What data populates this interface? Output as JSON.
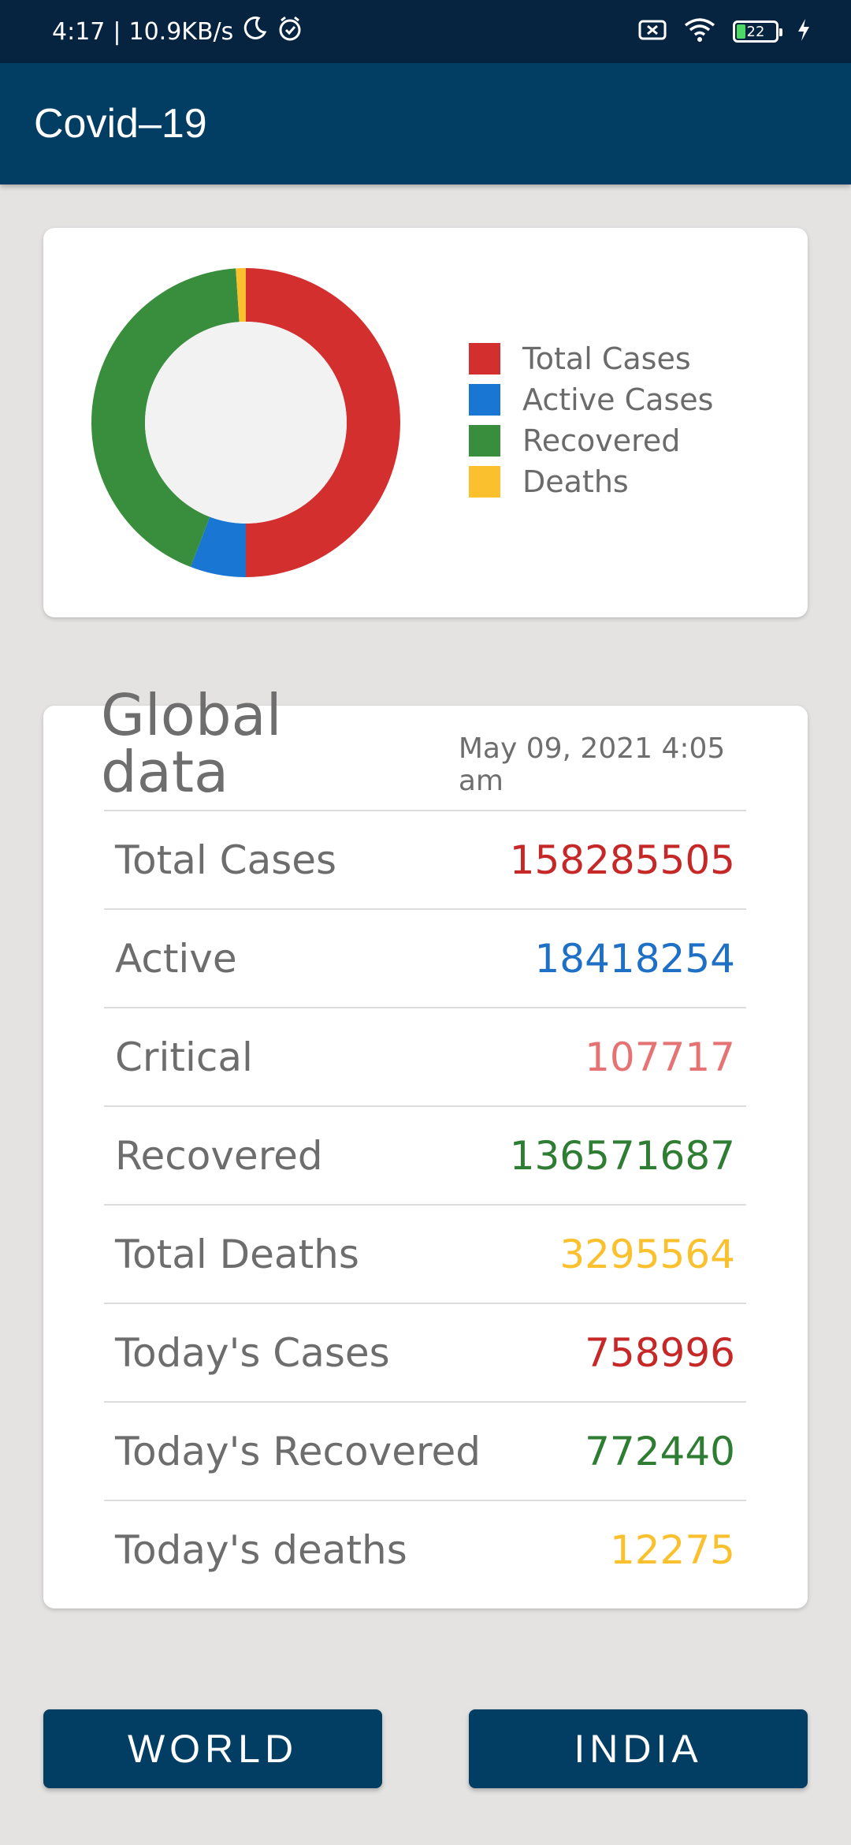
{
  "status_bar": {
    "time": "4:17",
    "speed": "10.9KB/s",
    "battery": "22"
  },
  "app": {
    "title": "Covid–19"
  },
  "chart_data": {
    "type": "pie",
    "style": "donut",
    "categories": [
      "Total Cases",
      "Active Cases",
      "Recovered",
      "Deaths"
    ],
    "values": [
      158285505,
      18418254,
      136571687,
      3295564
    ],
    "colors": [
      "#d32f2f",
      "#1976d2",
      "#388e3c",
      "#fbc02d"
    ],
    "legend_position": "right"
  },
  "global": {
    "title": "Global data",
    "date": "May 09, 2021 4:05 am",
    "rows": [
      {
        "label": "Total Cases",
        "value": "158285505",
        "color": "#c62828"
      },
      {
        "label": "Active",
        "value": "18418254",
        "color": "#1e70c6"
      },
      {
        "label": "Critical",
        "value": "107717",
        "color": "#e57373"
      },
      {
        "label": "Recovered",
        "value": "136571687",
        "color": "#2e7d32"
      },
      {
        "label": "Total Deaths",
        "value": "3295564",
        "color": "#fbc02d"
      },
      {
        "label": "Today's Cases",
        "value": "758996",
        "color": "#c62828"
      },
      {
        "label": "Today's Recovered",
        "value": "772440",
        "color": "#2e7d32"
      },
      {
        "label": "Today's deaths",
        "value": "12275",
        "color": "#fbc02d"
      }
    ]
  },
  "buttons": {
    "world": "WORLD",
    "india": "INDIA"
  }
}
